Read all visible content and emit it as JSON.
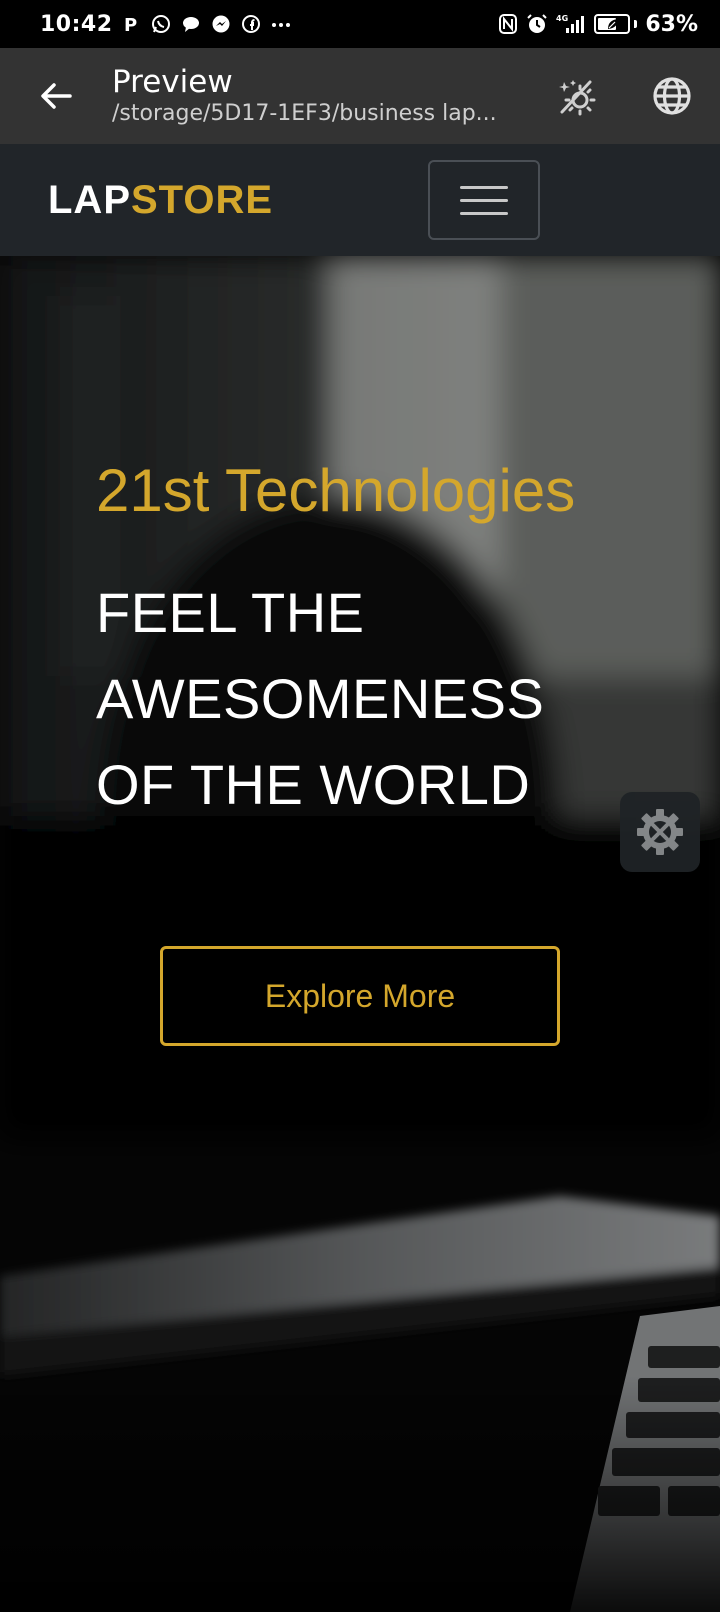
{
  "status_bar": {
    "time": "10:42",
    "notification_icons": [
      "parking-icon",
      "whatsapp-icon",
      "chat-icon",
      "messenger-icon",
      "facebook-icon",
      "more-dots-icon"
    ],
    "system_icons": [
      "nfc-icon",
      "alarm-icon",
      "signal-4g-icon",
      "battery-saver-icon"
    ],
    "network_label": "4G",
    "battery_percent": "63%",
    "battery_level": 0.63
  },
  "toolbar": {
    "title": "Preview",
    "subtitle": "/storage/5D17-1EF3/business lap...",
    "icons": [
      "back-arrow-icon",
      "theme-toggle-icon",
      "globe-icon"
    ]
  },
  "navbar": {
    "brand_part1": "LAP",
    "brand_part2": "STORE",
    "menu_icon": "hamburger-icon"
  },
  "hero": {
    "kicker": "21st Technologies",
    "heading_line1": "FEEL THE",
    "heading_line2": "AWESOMENESS",
    "heading_line3": "OF THE WORLD",
    "cta_label": "Explore More",
    "settings_icon": "gear-icon"
  },
  "colors": {
    "accent": "#d4a72c",
    "navbar_bg": "#212529",
    "toolbar_bg": "#333333",
    "status_bg": "#000000"
  }
}
